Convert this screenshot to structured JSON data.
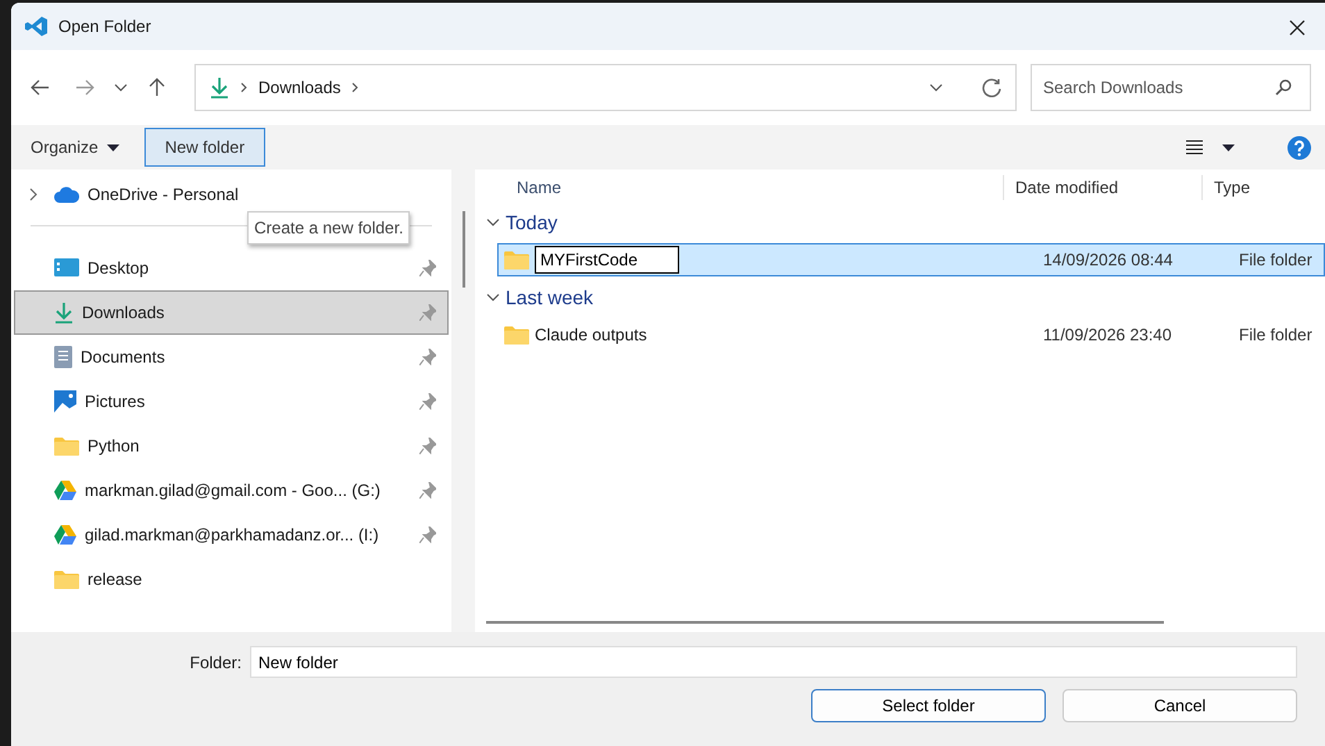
{
  "window": {
    "title": "Open Folder"
  },
  "address_bar": {
    "crumbs": [
      "Downloads"
    ]
  },
  "search": {
    "placeholder": "Search Downloads"
  },
  "toolbar": {
    "organize": "Organize",
    "new_folder": "New folder",
    "tooltip": "Create a new folder."
  },
  "sidebar": {
    "items": [
      {
        "label": "OneDrive - Personal",
        "kind": "onedrive",
        "expandable": true,
        "pinned": false,
        "selected": false
      },
      {
        "label": "Desktop",
        "kind": "desktop",
        "expandable": false,
        "pinned": true,
        "selected": false
      },
      {
        "label": "Downloads",
        "kind": "download",
        "expandable": false,
        "pinned": true,
        "selected": true
      },
      {
        "label": "Documents",
        "kind": "documents",
        "expandable": false,
        "pinned": true,
        "selected": false
      },
      {
        "label": "Pictures",
        "kind": "pictures",
        "expandable": false,
        "pinned": true,
        "selected": false
      },
      {
        "label": "Python",
        "kind": "folder",
        "expandable": false,
        "pinned": true,
        "selected": false
      },
      {
        "label": "markman.gilad@gmail.com - Goo... (G:)",
        "kind": "gdrive",
        "expandable": false,
        "pinned": true,
        "selected": false
      },
      {
        "label": "gilad.markman@parkhamadanz.or... (I:)",
        "kind": "gdrive",
        "expandable": false,
        "pinned": true,
        "selected": false
      },
      {
        "label": "release",
        "kind": "folder",
        "expandable": false,
        "pinned": false,
        "selected": false
      }
    ]
  },
  "columns": [
    "Name",
    "Date modified",
    "Type"
  ],
  "groups": [
    {
      "label": "Today",
      "expanded": true,
      "rows": [
        {
          "name": "MYFirstCode",
          "date": "14/09/2026 08:44",
          "type": "File folder",
          "selected": true,
          "renaming": true
        }
      ]
    },
    {
      "label": "Last week",
      "expanded": true,
      "rows": [
        {
          "name": "Claude outputs",
          "date": "11/09/2026 23:40",
          "type": "File folder",
          "selected": false,
          "renaming": false
        }
      ]
    }
  ],
  "footer": {
    "folder_label": "Folder:",
    "folder_value": "New folder",
    "buttons": [
      {
        "label": "Select folder",
        "kind": "primary"
      },
      {
        "label": "Cancel",
        "kind": "secondary"
      }
    ]
  }
}
